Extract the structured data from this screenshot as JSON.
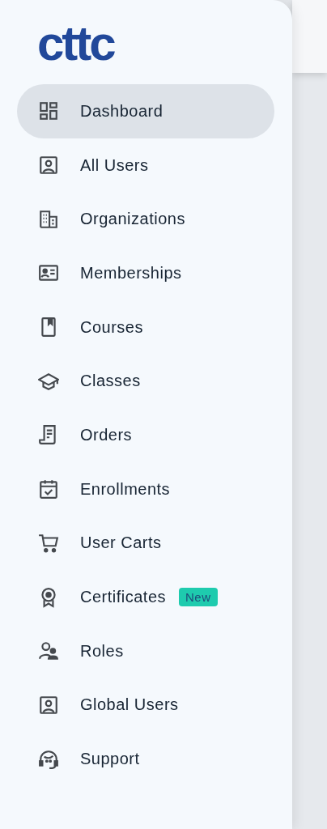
{
  "logo": "cttc",
  "nav": [
    {
      "label": "Dashboard",
      "selected": true
    },
    {
      "label": "All Users",
      "selected": false
    },
    {
      "label": "Organizations",
      "selected": false
    },
    {
      "label": "Memberships",
      "selected": false
    },
    {
      "label": "Courses",
      "selected": false
    },
    {
      "label": "Classes",
      "selected": false
    },
    {
      "label": "Orders",
      "selected": false
    },
    {
      "label": "Enrollments",
      "selected": false
    },
    {
      "label": "User Carts",
      "selected": false
    },
    {
      "label": "Certificates",
      "selected": false,
      "badge": "New"
    },
    {
      "label": "Roles",
      "selected": false
    },
    {
      "label": "Global Users",
      "selected": false
    },
    {
      "label": "Support",
      "selected": false
    }
  ]
}
